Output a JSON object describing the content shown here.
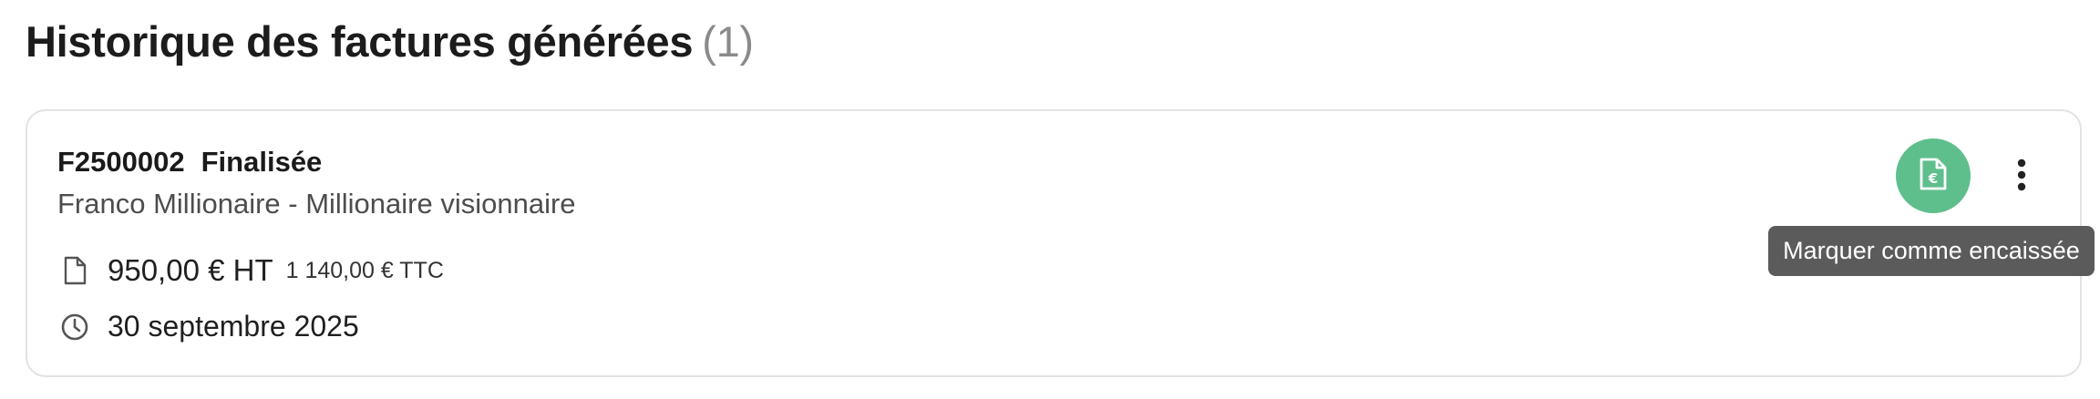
{
  "section": {
    "title": "Historique des factures générées",
    "count": "(1)"
  },
  "invoice": {
    "number": "F2500002",
    "status": "Finalisée",
    "client": "Franco Millionaire - Millionaire visionnaire",
    "amount_ht": "950,00 € HT",
    "amount_ttc": "1 140,00 € TTC",
    "date": "30 septembre 2025",
    "amount_icon": "document-icon",
    "date_icon": "clock-icon"
  },
  "actions": {
    "mark_paid_icon": "euro-file-icon",
    "more_icon": "more-vertical-icon",
    "tooltip": "Marquer comme encaissée"
  },
  "colors": {
    "accent_green": "#5fbf8c",
    "tooltip_bg": "#5b5b5b"
  }
}
